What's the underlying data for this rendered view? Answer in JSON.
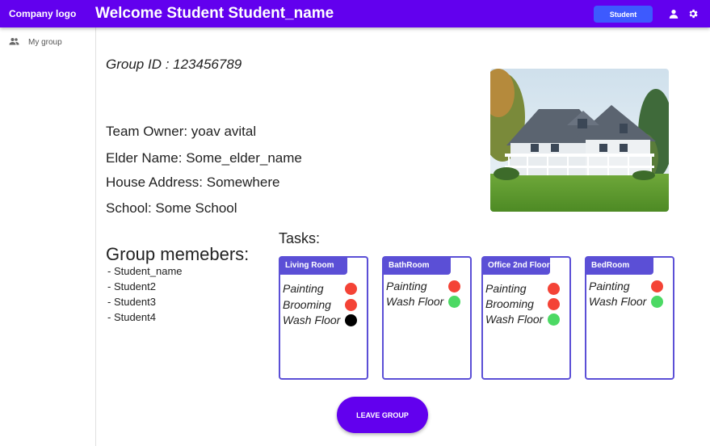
{
  "header": {
    "logo": "Company logo",
    "welcome": "Welcome Student Student_name",
    "role_button": "Student"
  },
  "sidebar": {
    "items": [
      {
        "label": "My group",
        "icon": "group-icon"
      }
    ]
  },
  "group": {
    "id_text": "Group ID : 123456789",
    "team_owner": "Team Owner: yoav avital",
    "elder_name": "Elder Name: Some_elder_name",
    "house_address": "House Address: Somewhere",
    "school": "School: Some School"
  },
  "members": {
    "title": "Group memebers:",
    "list": [
      "- Student_name",
      "- Student2",
      "- Student3",
      "- Student4"
    ]
  },
  "tasks": {
    "title": "Tasks:",
    "cards": [
      {
        "room": "Living Room",
        "items": [
          {
            "name": "Painting",
            "status_color": "#f44336"
          },
          {
            "name": "Brooming",
            "status_color": "#f44336"
          },
          {
            "name": "Wash Floor",
            "status_color": "#000000"
          }
        ]
      },
      {
        "room": "BathRoom",
        "items": [
          {
            "name": "Painting",
            "status_color": "#f44336"
          },
          {
            "name": "Wash Floor",
            "status_color": "#4cd964"
          }
        ]
      },
      {
        "room": "Office 2nd Floor",
        "items": [
          {
            "name": "Painting",
            "status_color": "#f44336"
          },
          {
            "name": "Brooming",
            "status_color": "#f44336"
          },
          {
            "name": "Wash Floor",
            "status_color": "#4cd964"
          }
        ]
      },
      {
        "room": "BedRoom",
        "items": [
          {
            "name": "Painting",
            "status_color": "#f44336"
          },
          {
            "name": "Wash Floor",
            "status_color": "#4cd964"
          }
        ]
      }
    ]
  },
  "actions": {
    "leave_group": "LEAVE GROUP"
  },
  "colors": {
    "primary": "#6200ee",
    "accent": "#3d5afe",
    "card_border": "#5b4fd6"
  }
}
